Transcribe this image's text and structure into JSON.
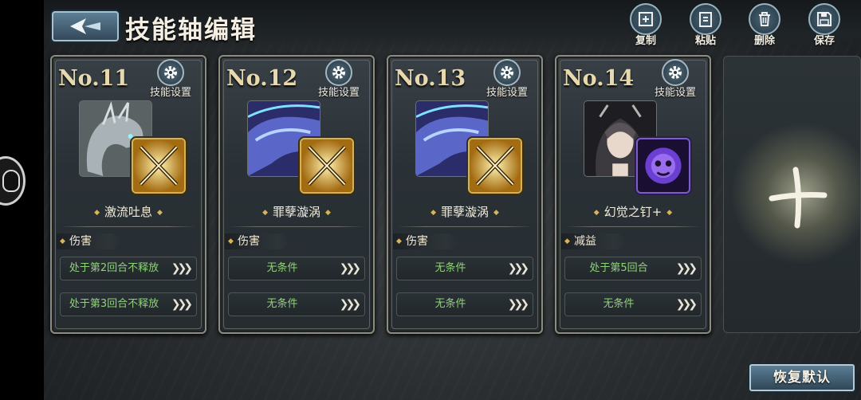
{
  "header": {
    "title": "技能轴编辑",
    "tools": [
      {
        "label": "复制",
        "icon": "copy-icon"
      },
      {
        "label": "粘贴",
        "icon": "paste-icon"
      },
      {
        "label": "删除",
        "icon": "trash-icon"
      },
      {
        "label": "保存",
        "icon": "save-icon"
      }
    ]
  },
  "cards": [
    {
      "no": "No.11",
      "settings_label": "技能设置",
      "skill": "激流吐息",
      "type": "伤害",
      "conditions": [
        "处于第2回合不释放",
        "处于第3回合不释放"
      ],
      "portrait": "bone-dragon-portrait",
      "skill_icon": "crossed-swords-icon"
    },
    {
      "no": "No.12",
      "settings_label": "技能设置",
      "skill": "罪孽漩涡",
      "type": "伤害",
      "conditions": [
        "无条件",
        "无条件"
      ],
      "portrait": "blue-dragon-portrait",
      "skill_icon": "crossed-swords-icon"
    },
    {
      "no": "No.13",
      "settings_label": "技能设置",
      "skill": "罪孽漩涡",
      "type": "伤害",
      "conditions": [
        "无条件",
        "无条件"
      ],
      "portrait": "blue-dragon-portrait",
      "skill_icon": "crossed-swords-icon"
    },
    {
      "no": "No.14",
      "settings_label": "技能设置",
      "skill": "幻觉之钉+",
      "type": "减益",
      "conditions": [
        "处于第5回合",
        "无条件"
      ],
      "portrait": "dark-girl-portrait",
      "skill_icon": "purple-skull-icon"
    }
  ],
  "arrows_glyph": "❯❯❯",
  "restore_label": "恢复默认",
  "colors": {
    "condition_text": "#8fd27a",
    "accent_gold": "#d7b45c",
    "button_blue": "#4a6a80"
  }
}
